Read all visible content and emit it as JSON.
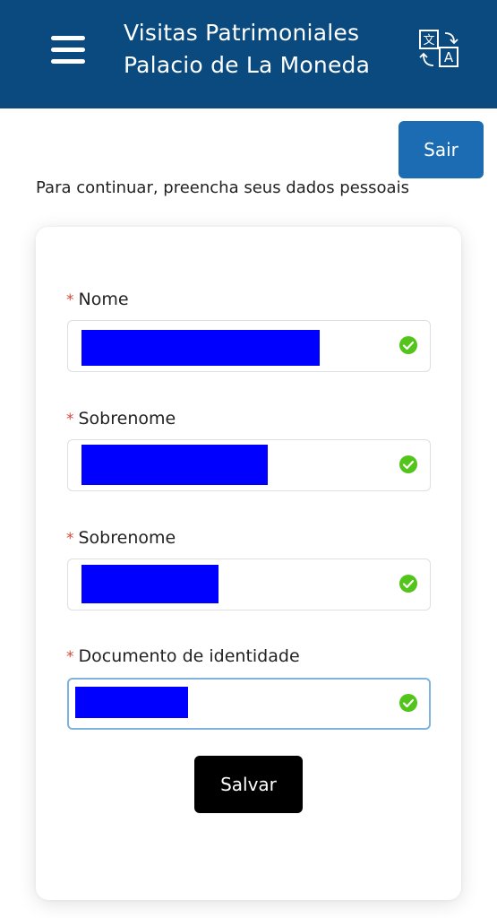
{
  "header": {
    "title_line1": "Visitas Patrimoniales",
    "title_line2": "Palacio de La Moneda",
    "menu_icon": "hamburger-menu-icon",
    "language_icon": "translate-icon",
    "background_color": "#0a4a7e"
  },
  "logout_button": {
    "label": "Sair",
    "color": "#1c6cb3"
  },
  "instructions": "Para continuar, preencha seus dados pessoais",
  "form": {
    "required_marker": "*",
    "fields": [
      {
        "label": "Nome",
        "value_redacted": true,
        "status_icon": "check-circle-icon"
      },
      {
        "label": "Sobrenome",
        "value_redacted": true,
        "status_icon": "check-circle-icon"
      },
      {
        "label": "Sobrenome",
        "value_redacted": true,
        "status_icon": "check-circle-icon"
      },
      {
        "label": "Documento de identidade",
        "value_redacted": true,
        "status_icon": "check-circle-icon"
      }
    ],
    "save_label": "Salvar",
    "valid_color": "#52c41a",
    "redaction_color": "#0000ff"
  }
}
